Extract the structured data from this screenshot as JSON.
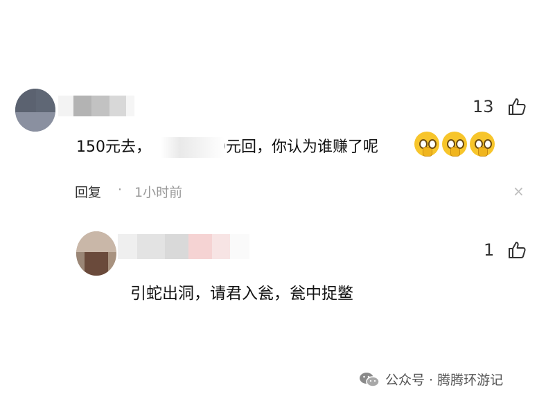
{
  "comments": [
    {
      "username_visible": false,
      "likes": "13",
      "text_prefix": "150元去，",
      "text_suffix": "0元回，你认为谁赚了呢",
      "reply_label": "回复",
      "separator": "·",
      "time": "1小时前",
      "close_glyph": "×",
      "emoji_icons": [
        "grimacing-face-icon",
        "grimacing-face-icon",
        "grimacing-face-icon"
      ]
    },
    {
      "username_visible": false,
      "likes": "1",
      "text": "引蛇出洞，请君入瓮，瓮中捉鳖"
    }
  ],
  "watermark": {
    "text": "公众号 · 腾腾环游记",
    "icon": "wechat-icon"
  },
  "colors": {
    "text": "#111111",
    "meta": "#999999",
    "emoji": "#f7c52b"
  }
}
